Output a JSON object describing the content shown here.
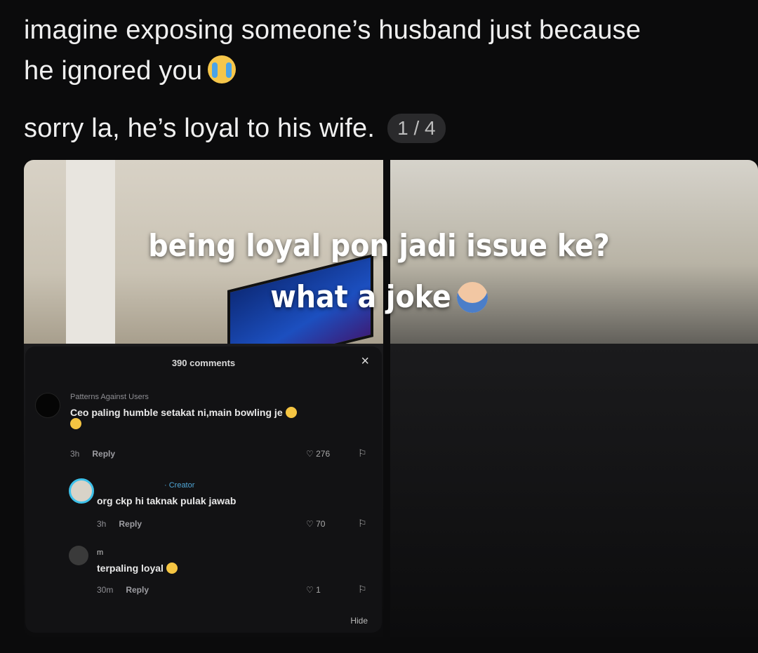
{
  "post": {
    "line1": "imagine exposing someone’s husband just because",
    "line2": "he ignored you",
    "line3": "sorry la, he’s loyal to his wife.",
    "counter": "1 / 4"
  },
  "overlay": {
    "caption1": "being loyal pon jadi issue ke?",
    "caption2": "what a joke"
  },
  "comments_panel": {
    "count_label": "390 comments",
    "close_icon": "×",
    "hide_label": "Hide",
    "items": [
      {
        "username": "Patterns Against Users",
        "text": "Ceo paling humble setakat ni,main bowling je",
        "time": "3h",
        "reply_label": "Reply",
        "likes": "276"
      },
      {
        "username": "",
        "creator_tag": "· Creator",
        "text": "org ckp hi taknak pulak jawab",
        "time": "3h",
        "reply_label": "Reply",
        "likes": "70"
      },
      {
        "username": "m",
        "text": "terpaling loyal",
        "time": "30m",
        "reply_label": "Reply",
        "likes": "1"
      }
    ]
  },
  "colors": {
    "accent_creator": "#4fa6d6",
    "background": "#0b0b0c"
  }
}
